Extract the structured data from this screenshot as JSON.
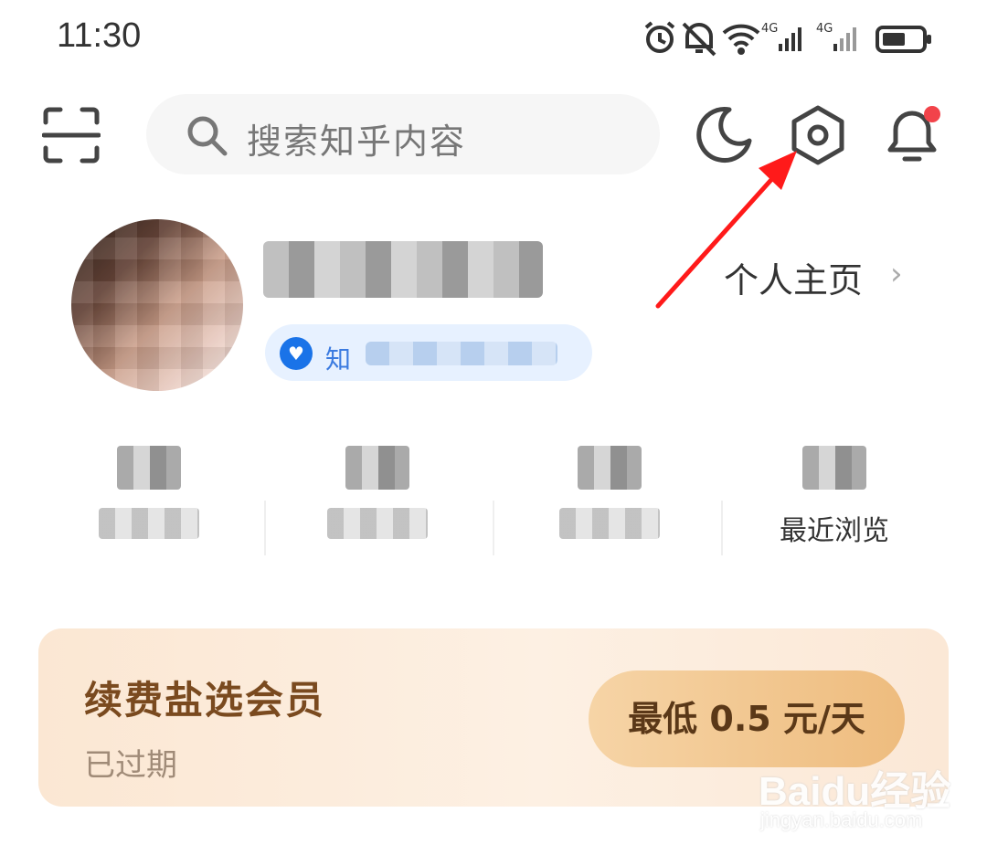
{
  "status_bar": {
    "time": "11:30",
    "network_label_1": "4G",
    "network_label_2": "4G",
    "icons": [
      "alarm-icon",
      "mute-bell-icon",
      "wifi-icon",
      "signal-4g-icon",
      "signal-4g-icon",
      "battery-icon"
    ]
  },
  "header": {
    "scan_icon": "scan-icon",
    "search_placeholder": "搜索知乎内容",
    "dark_mode_icon": "moon-icon",
    "settings_icon": "hexagon-settings-icon",
    "notification_icon": "bell-icon",
    "notification_dot_color": "#f2434a"
  },
  "profile": {
    "badge_text_visible": "知",
    "homepage_link": "个人主页"
  },
  "stats": [
    {
      "label": ""
    },
    {
      "label": ""
    },
    {
      "label": ""
    },
    {
      "label": "最近浏览"
    }
  ],
  "member": {
    "title": "续费盐选会员",
    "status": "已过期",
    "button_label": "最低 0.5 元/天"
  },
  "watermark": {
    "main": "Baidu经验",
    "sub": "jingyan.baidu.com"
  },
  "annotation": {
    "arrow_color": "#ff1a1a"
  }
}
